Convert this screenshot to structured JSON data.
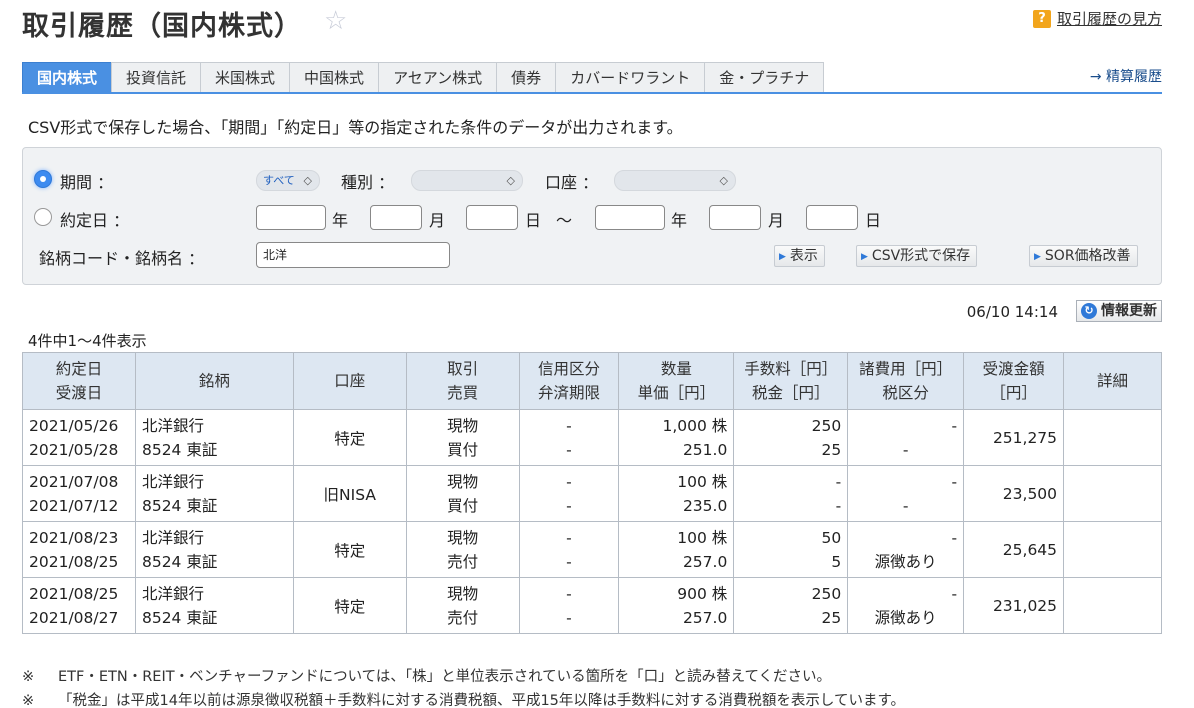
{
  "page": {
    "title": "取引履歴（国内株式）",
    "help_icon": "?",
    "help_link": "取引履歴の見方"
  },
  "tabs": [
    {
      "label": "国内株式",
      "active": true
    },
    {
      "label": "投資信託"
    },
    {
      "label": "米国株式"
    },
    {
      "label": "中国株式"
    },
    {
      "label": "アセアン株式"
    },
    {
      "label": "債券"
    },
    {
      "label": "カバードワラント"
    },
    {
      "label": "金・プラチナ"
    }
  ],
  "settle_link": "→ 精算履歴",
  "note": "CSV形式で保存した場合、「期間」「約定日」等の指定された条件のデータが出力されます。",
  "search": {
    "period_label": "期間 ：",
    "period_value": "すべて",
    "type_label": "種別 ：",
    "type_value": "",
    "account_label": "口座 ：",
    "account_value": "",
    "trade_date_label": "約定日 ：",
    "year": "年",
    "month": "月",
    "day": "日",
    "tilde": "〜",
    "code_label": "銘柄コード・銘柄名 ：",
    "code_value": "北洋",
    "btn_show": "表示",
    "btn_csv": "CSV形式で保存",
    "btn_sor": "SOR価格改善"
  },
  "status": {
    "timestamp": "06/10 14:14",
    "refresh_label": "情報更新",
    "count": "4件中1〜4件表示"
  },
  "table": {
    "headers": [
      [
        "約定日",
        "受渡日"
      ],
      [
        "銘柄",
        ""
      ],
      [
        "口座",
        ""
      ],
      [
        "取引",
        "売買"
      ],
      [
        "信用区分",
        "弁済期限"
      ],
      [
        "数量",
        "単価［円］"
      ],
      [
        "手数料［円］",
        "税金［円］"
      ],
      [
        "諸費用［円］",
        "税区分"
      ],
      [
        "受渡金額",
        "［円］"
      ],
      [
        "詳細",
        ""
      ]
    ],
    "rows": [
      {
        "trade_date": "2021/05/26",
        "settle_date": "2021/05/28",
        "name": "北洋銀行",
        "code": "8524 東証",
        "account": "特定",
        "trade": "現物",
        "side": "買付",
        "credit": "-",
        "due": "-",
        "qty": "1,000 株",
        "price": "251.0",
        "fee": "250",
        "tax": "25",
        "cost": "-",
        "tax_class": "-",
        "amount": "251,275"
      },
      {
        "trade_date": "2021/07/08",
        "settle_date": "2021/07/12",
        "name": "北洋銀行",
        "code": "8524 東証",
        "account": "旧NISA",
        "trade": "現物",
        "side": "買付",
        "credit": "-",
        "due": "-",
        "qty": "100 株",
        "price": "235.0",
        "fee": "-",
        "tax": "-",
        "cost": "-",
        "tax_class": "-",
        "amount": "23,500"
      },
      {
        "trade_date": "2021/08/23",
        "settle_date": "2021/08/25",
        "name": "北洋銀行",
        "code": "8524 東証",
        "account": "特定",
        "trade": "現物",
        "side": "売付",
        "credit": "-",
        "due": "-",
        "qty": "100 株",
        "price": "257.0",
        "fee": "50",
        "tax": "5",
        "cost": "-",
        "tax_class": "源徴あり",
        "amount": "25,645"
      },
      {
        "trade_date": "2021/08/25",
        "settle_date": "2021/08/27",
        "name": "北洋銀行",
        "code": "8524 東証",
        "account": "特定",
        "trade": "現物",
        "side": "売付",
        "credit": "-",
        "due": "-",
        "qty": "900 株",
        "price": "257.0",
        "fee": "250",
        "tax": "25",
        "cost": "-",
        "tax_class": "源徴あり",
        "amount": "231,025"
      }
    ]
  },
  "footnotes": [
    {
      "mark": "※",
      "text": "ETF・ETN・REIT・ベンチャーファンドについては、「株」と単位表示されている箇所を「口」と読み替えてください。"
    },
    {
      "mark": "※",
      "text": "「税金」は平成14年以前は源泉徴収税額＋手数料に対する消費税額、平成15年以降は手数料に対する消費税額を表示しています。"
    }
  ],
  "icons": {
    "star": "star-icon",
    "help": "question-icon",
    "refresh": "refresh-icon",
    "chevron": "chevron-updown-icon"
  },
  "colors": {
    "accent": "#4a90e2",
    "header_bg": "#dde7f2",
    "help_icon": "#f2a51c"
  }
}
